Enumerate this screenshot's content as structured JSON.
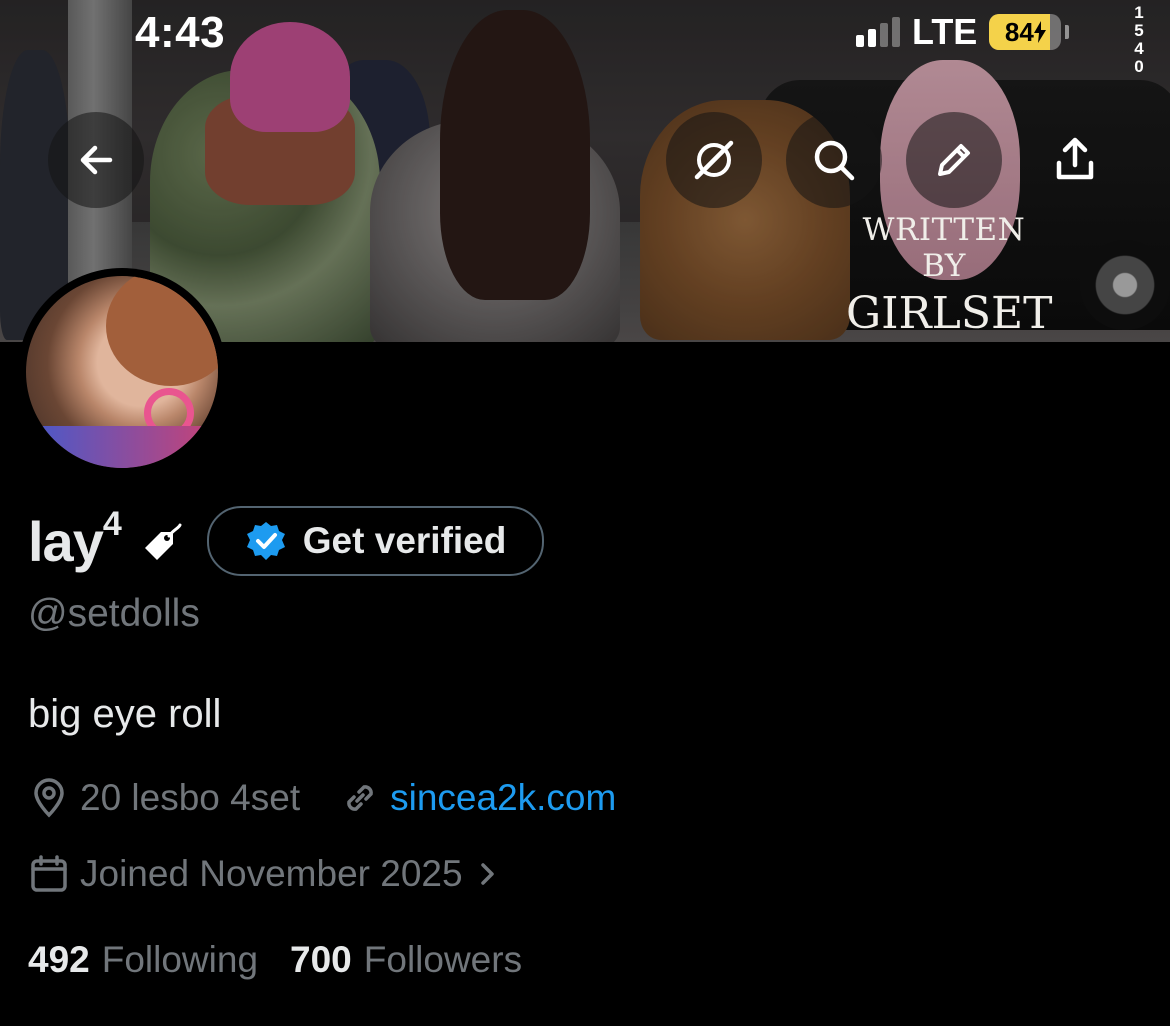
{
  "status_bar": {
    "time": "4:43",
    "network": "LTE",
    "battery": "84"
  },
  "floor_sign": [
    "1",
    "5",
    "4",
    "0"
  ],
  "header": {
    "back_icon": "arrow-left-icon",
    "grok_icon": "grok-icon",
    "search_icon": "search-icon",
    "edit_icon": "pencil-icon",
    "share_icon": "share-icon"
  },
  "banner": {
    "watermark_line1": "WRITTEN BY",
    "watermark_line2": "GIRLSET"
  },
  "profile": {
    "name": "lay",
    "name_superscript": "4",
    "get_verified_label": "Get verified",
    "handle": "@setdolls",
    "bio": "big eye roll",
    "location": "20 lesbo 4set",
    "website": "sincea2k.com",
    "joined": "Joined November 2025",
    "following_count": "492",
    "following_label": "Following",
    "followers_count": "700",
    "followers_label": "Followers"
  },
  "colors": {
    "accent": "#1d9bf0",
    "muted": "#71767b",
    "text": "#e7e9ea",
    "background": "#000000",
    "battery": "#f4d24a"
  }
}
